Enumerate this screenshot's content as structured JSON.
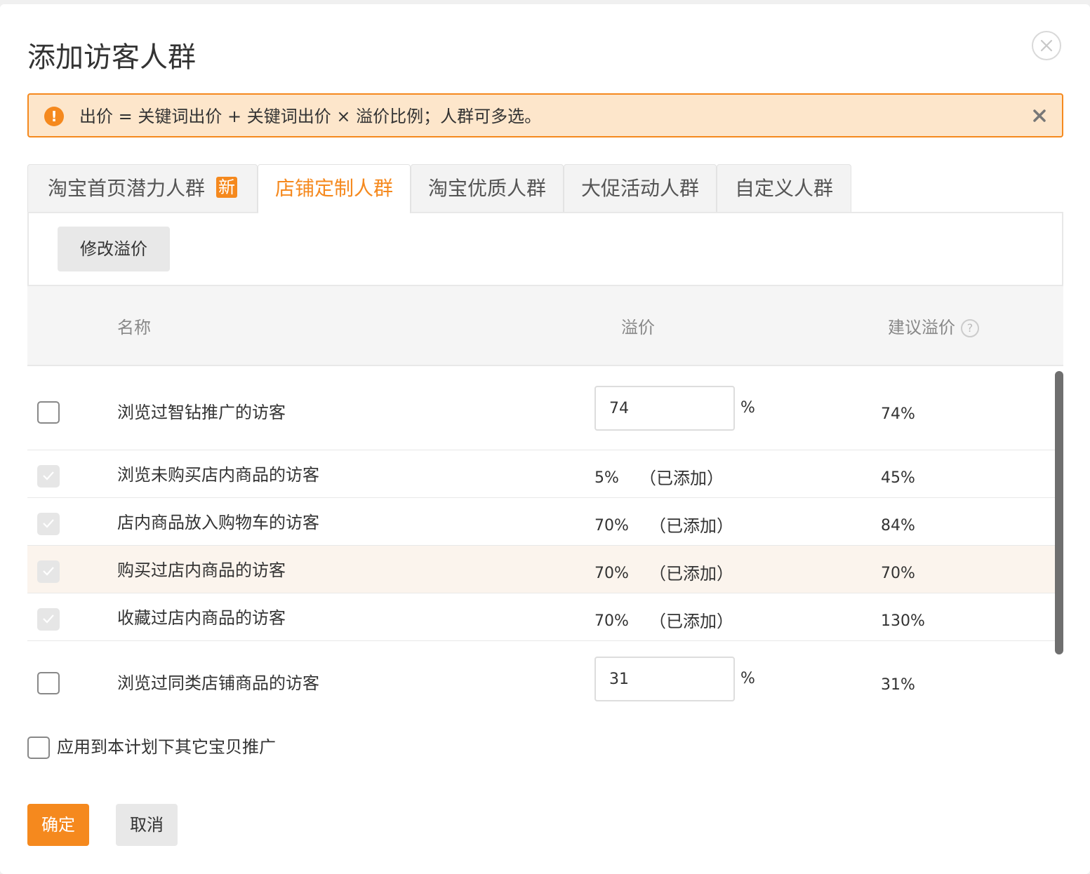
{
  "dialog": {
    "title": "添加访客人群",
    "close_icon": "close-circle-icon"
  },
  "alert": {
    "icon": "exclamation-icon",
    "icon_text": "!",
    "text": "出价 = 关键词出价 + 关键词出价 × 溢价比例；人群可多选。",
    "close_icon": "close-icon"
  },
  "tabs": [
    {
      "label": "淘宝首页潜力人群",
      "badge": "新",
      "active": false
    },
    {
      "label": "店铺定制人群",
      "active": true
    },
    {
      "label": "淘宝优质人群",
      "active": false
    },
    {
      "label": "大促活动人群",
      "active": false
    },
    {
      "label": "自定义人群",
      "active": false
    }
  ],
  "toolbar": {
    "modify_label": "修改溢价"
  },
  "table": {
    "headers": {
      "name": "名称",
      "premium": "溢价",
      "suggested": "建议溢价",
      "help_icon": "question-icon",
      "help_text": "?"
    },
    "percent_sign": "%",
    "rows": [
      {
        "name": "浏览过智钻推广的访客",
        "checked": false,
        "editable": true,
        "premium": "74",
        "suggested": "74%"
      },
      {
        "name": "浏览未购买店内商品的访客",
        "checked": true,
        "editable": false,
        "premium": "5%",
        "status": "（已添加）",
        "suggested": "45%"
      },
      {
        "name": "店内商品放入购物车的访客",
        "checked": true,
        "editable": false,
        "premium": "70%",
        "status": "（已添加）",
        "suggested": "84%"
      },
      {
        "name": "购买过店内商品的访客",
        "checked": true,
        "editable": false,
        "premium": "70%",
        "status": "（已添加）",
        "suggested": "70%",
        "hovered": true
      },
      {
        "name": "收藏过店内商品的访客",
        "checked": true,
        "editable": false,
        "premium": "70%",
        "status": "（已添加）",
        "suggested": "130%"
      },
      {
        "name": "浏览过同类店铺商品的访客",
        "checked": false,
        "editable": true,
        "premium": "31",
        "suggested": "31%"
      }
    ]
  },
  "apply_other": {
    "label": "应用到本计划下其它宝贝推广",
    "checked": false
  },
  "footer": {
    "ok_label": "确定",
    "cancel_label": "取消"
  },
  "colors": {
    "accent": "#f5891e",
    "alert_bg": "#fde6cb",
    "hover_row": "#fbf4ed"
  }
}
